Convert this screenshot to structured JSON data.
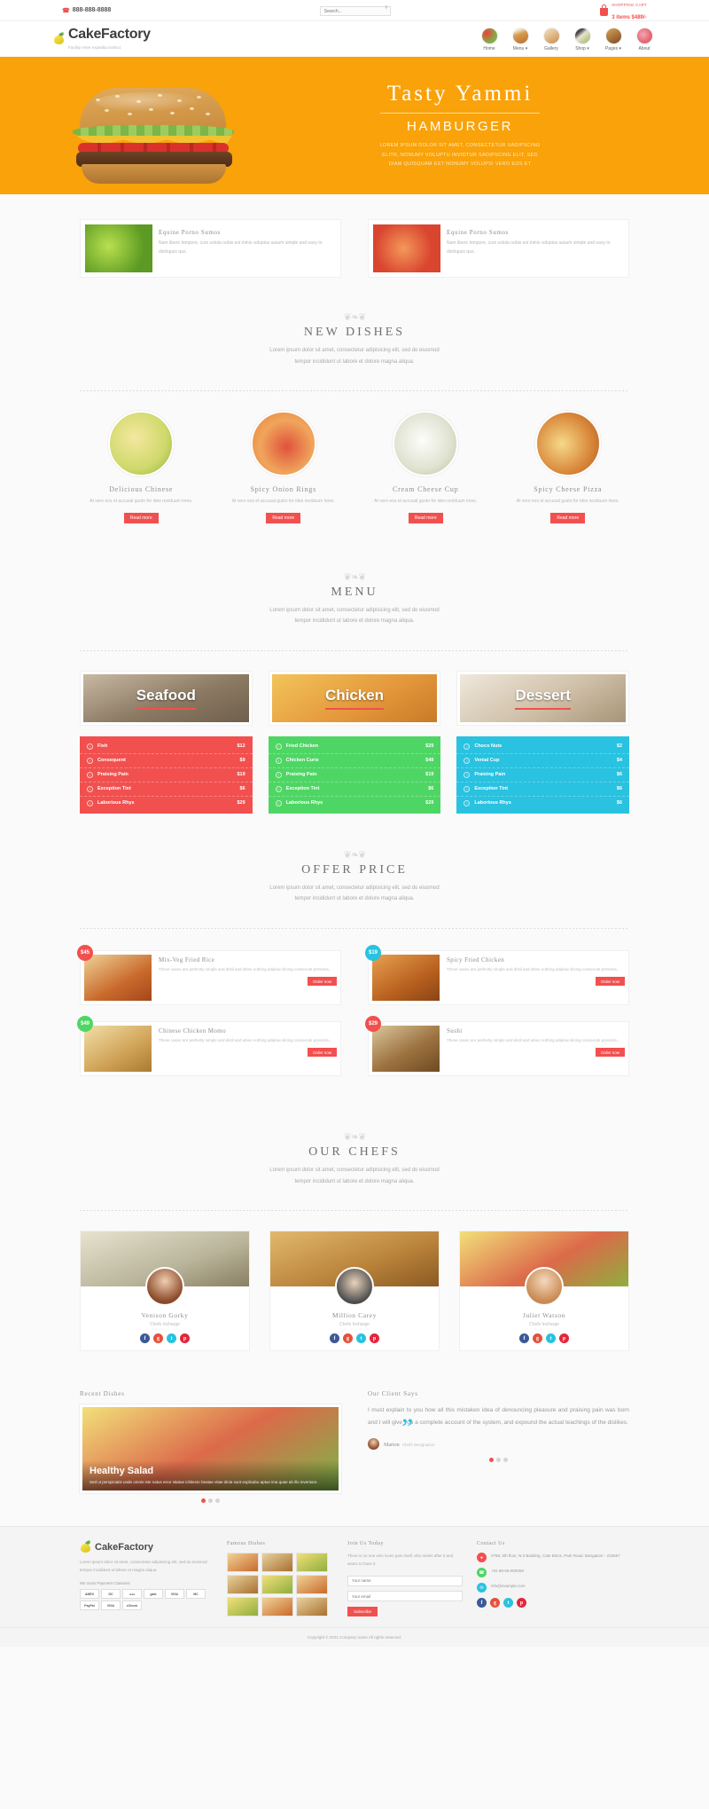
{
  "topbar": {
    "phone": "888-888-8888",
    "search_placeholder": "Search...",
    "cart_label": "SHOPPING CART",
    "cart_items": "3 items $489/-"
  },
  "header": {
    "logo_name": "CakeFactory",
    "logo_tagline": "Facility enter expedita instinct.",
    "nav": [
      {
        "label": "Home",
        "icon": "home-thumb"
      },
      {
        "label": "Menu ▾",
        "icon": "menu-thumb"
      },
      {
        "label": "Gallery",
        "icon": "gallery-thumb"
      },
      {
        "label": "Shop ▾",
        "icon": "shop-thumb"
      },
      {
        "label": "Pages ▾",
        "icon": "pages-thumb"
      },
      {
        "label": "About",
        "icon": "about-thumb"
      }
    ]
  },
  "hero": {
    "title": "Tasty Yammi",
    "subtitle": "HAMBURGER",
    "desc_line1": "LOREM IPSUM DOLOR SIT AMET, CONSECTETUR SADIPSCING",
    "desc_line2": "ELITR, NONUMY VOLUPTU INVIDTUR SADIPSCING ELIT, SED",
    "desc_line3": "DIAM QUISQUAM EST NONUMY VOLUPSI VERO EOS ET"
  },
  "promos": [
    {
      "title": "Equine Porno Sumos",
      "text": "Nam libero tempore, cum soluta nobis est minis voluptas assum simple and easy to distinguis quo.",
      "icon": "lime-image"
    },
    {
      "title": "Equine Porno Sumos",
      "text": "Nam libero tempore, cum soluta nobis est minis voluptas assum simple and easy to distinguis quo.",
      "icon": "fruit-image"
    }
  ],
  "new_dishes": {
    "heading": "NEW DISHES",
    "sub_line1": "Lorem ipsum dolor sit amet, consectetur adipisicing elit, sed do eiusmod",
    "sub_line2": "tempor incididunt ut labore et dolore magna aliqua.",
    "items": [
      {
        "name": "Delicious Chinese",
        "text": "At vero eos et accusal gusto for ides residuum lores.",
        "button": "Read more"
      },
      {
        "name": "Spicy Onion Rings",
        "text": "At vero eos et accusal gusto for ides residuum lores.",
        "button": "Read more"
      },
      {
        "name": "Cream Cheese Cup",
        "text": "At vero eos et accusal gusto for ides residuum lores.",
        "button": "Read more"
      },
      {
        "name": "Spicy Cheese Pizza",
        "text": "At vero eos et accusal gusto for ides residuum lores.",
        "button": "Read more"
      }
    ]
  },
  "menu": {
    "heading": "MENU",
    "sub_line1": "Lorem ipsum dolor sit amet, consectetur adipisicing elit, sed do eiusmod",
    "sub_line2": "tempor incididunt ut labore et dolore magna aliqua.",
    "categories": [
      {
        "label": "Seafood",
        "color": "#f1504f",
        "items": [
          {
            "name": "Fish",
            "price": "$12"
          },
          {
            "name": "Consequent",
            "price": "$9"
          },
          {
            "name": "Praising Pain",
            "price": "$19"
          },
          {
            "name": "Exception Tint",
            "price": "$6"
          },
          {
            "name": "Laborious Rhys",
            "price": "$29"
          }
        ]
      },
      {
        "label": "Chicken",
        "color": "#4ed664",
        "items": [
          {
            "name": "Fried Chicken",
            "price": "$29"
          },
          {
            "name": "Chicken Curie",
            "price": "$49"
          },
          {
            "name": "Praising Pain",
            "price": "$19"
          },
          {
            "name": "Exception Tint",
            "price": "$6"
          },
          {
            "name": "Laborious Rhys",
            "price": "$29"
          }
        ]
      },
      {
        "label": "Dessert",
        "color": "#29c2e0",
        "items": [
          {
            "name": "Choco Nuts",
            "price": "$2"
          },
          {
            "name": "Venial Cup",
            "price": "$4"
          },
          {
            "name": "Praising Pain",
            "price": "$6"
          },
          {
            "name": "Exception Tint",
            "price": "$6"
          },
          {
            "name": "Laborious Rhys",
            "price": "$6"
          }
        ]
      }
    ]
  },
  "offers": {
    "heading": "OFFER PRICE",
    "sub_line1": "Lorem ipsum dolor sit amet, consectetur adipisicing elit, sed do eiusmod",
    "sub_line2": "tempor incididunt ut labore et dolore magna aliqua.",
    "items": [
      {
        "badge": "$45",
        "badge_color": "#f1504f",
        "title": "Mix-Veg Fried Rice",
        "text": "These cases are perfectly simple and distil and when nothing adipisw slicing consecute presents...",
        "button": "Order now"
      },
      {
        "badge": "$19",
        "badge_color": "#29c2e0",
        "title": "Spicy Fried Chicken",
        "text": "These cases are perfectly simple and distil and when nothing adipisw slicing consecute presents...",
        "button": "Order now"
      },
      {
        "badge": "$49",
        "badge_color": "#4ed664",
        "title": "Chinese Chicken Momo",
        "text": "These cases are perfectly simple and distil and when nothing adipisw slicing consecute presents...",
        "button": "Order now"
      },
      {
        "badge": "$29",
        "badge_color": "#f1504f",
        "title": "Sushi",
        "text": "These cases are perfectly simple and distil and when nothing adipisw slicing consecute presents...",
        "button": "Order now"
      }
    ]
  },
  "chefs": {
    "heading": "OUR CHEFS",
    "sub_line1": "Lorem ipsum dolor sit amet, consectetur adipisicing elit, sed do eiusmod",
    "sub_line2": "tempor incididunt ut labore et dolore magna aliqua.",
    "items": [
      {
        "name": "Venison Gorky",
        "role": "Chefs Incharge"
      },
      {
        "name": "Million Carey",
        "role": "Chefs Incharge"
      },
      {
        "name": "Juliet Watson",
        "role": "Chefs Incharge"
      }
    ],
    "social_icons": [
      "facebook-icon",
      "google-plus-icon",
      "twitter-icon",
      "pinterest-icon"
    ]
  },
  "recent": {
    "heading": "Recent Dishes",
    "card_title": "Healthy Salad",
    "card_text": "Sed ut perspiciatis unde omnis iste natus error sitatue ichitecto beatae vitae dicta sunt explicabo aptue ima quae ab illo inventore."
  },
  "testimonial": {
    "heading": "Our Client Says",
    "quote": "I must explain to you how all this mistaken idea of denouncing pleasure and praising pain was born and I will give you a complete account of the system, and expound the actual teachings of the dislikes.",
    "author": "Marton",
    "author_role": "Chefs Designation"
  },
  "footer": {
    "logo_name": "CakeFactory",
    "about_text": "Lorem ipsum dolor sit amet, consectetur adipisicing elit, sed do eiusmod tempor incididunt ut labore et magna aliqua.",
    "payment_head": "We Scan Payment  Classess",
    "cards": [
      "AMEX",
      "DC",
      "●●●",
      "gate",
      "VISA",
      "MC",
      "PayPal",
      "VISA",
      "eCheck"
    ],
    "famous_head": "Famous Dishes",
    "join_head": "Join Us Today",
    "join_text": "There is no one who loves pain itself, who seeks after it and wants to have it.",
    "name_placeholder": "Your name",
    "email_placeholder": "Your email",
    "subscribe_label": "Subscribe",
    "contact_head": "Contact Us",
    "address": "#768, 5th floor, N-3 Building, Cate Block, Park Road, Bangalore - 234567",
    "phone": "+91 88-66-000058",
    "email": "info@example.com",
    "social_icons": [
      "facebook-icon",
      "google-plus-icon",
      "twitter-icon",
      "pinterest-icon"
    ],
    "copyright": "Copyright © 2021 Company name All rights reserved."
  }
}
